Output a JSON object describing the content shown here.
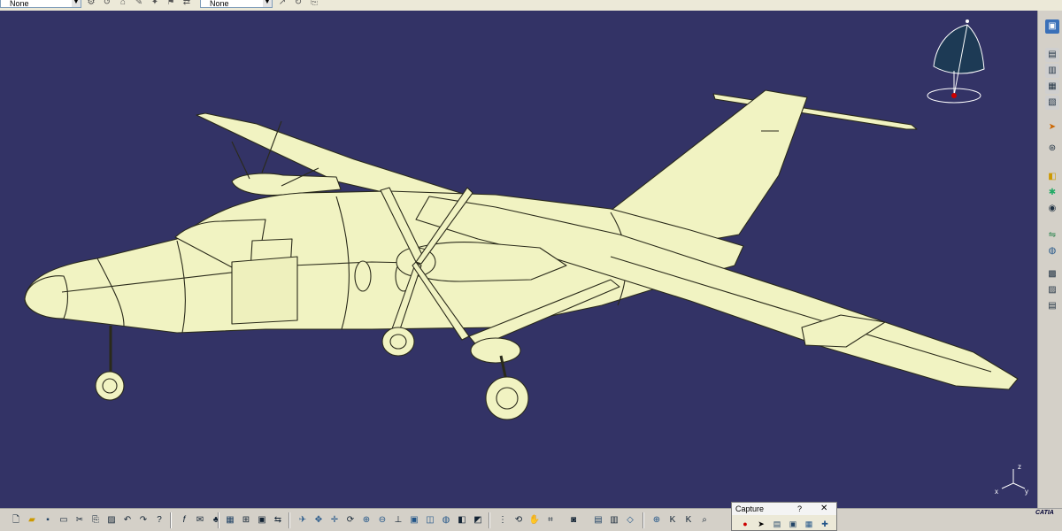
{
  "top_toolbar": {
    "combo_left_value": "None",
    "combo_right_value": "None"
  },
  "capture_panel": {
    "title": "Capture",
    "help": "?",
    "close": "✕"
  },
  "brand": {
    "name": "CATIA"
  },
  "axis_labels": {
    "z": "z",
    "x": "x",
    "y": "y"
  },
  "colors": {
    "background": "#333366",
    "model_fill": "#f1f3c2",
    "compass": "#1d3a55"
  }
}
